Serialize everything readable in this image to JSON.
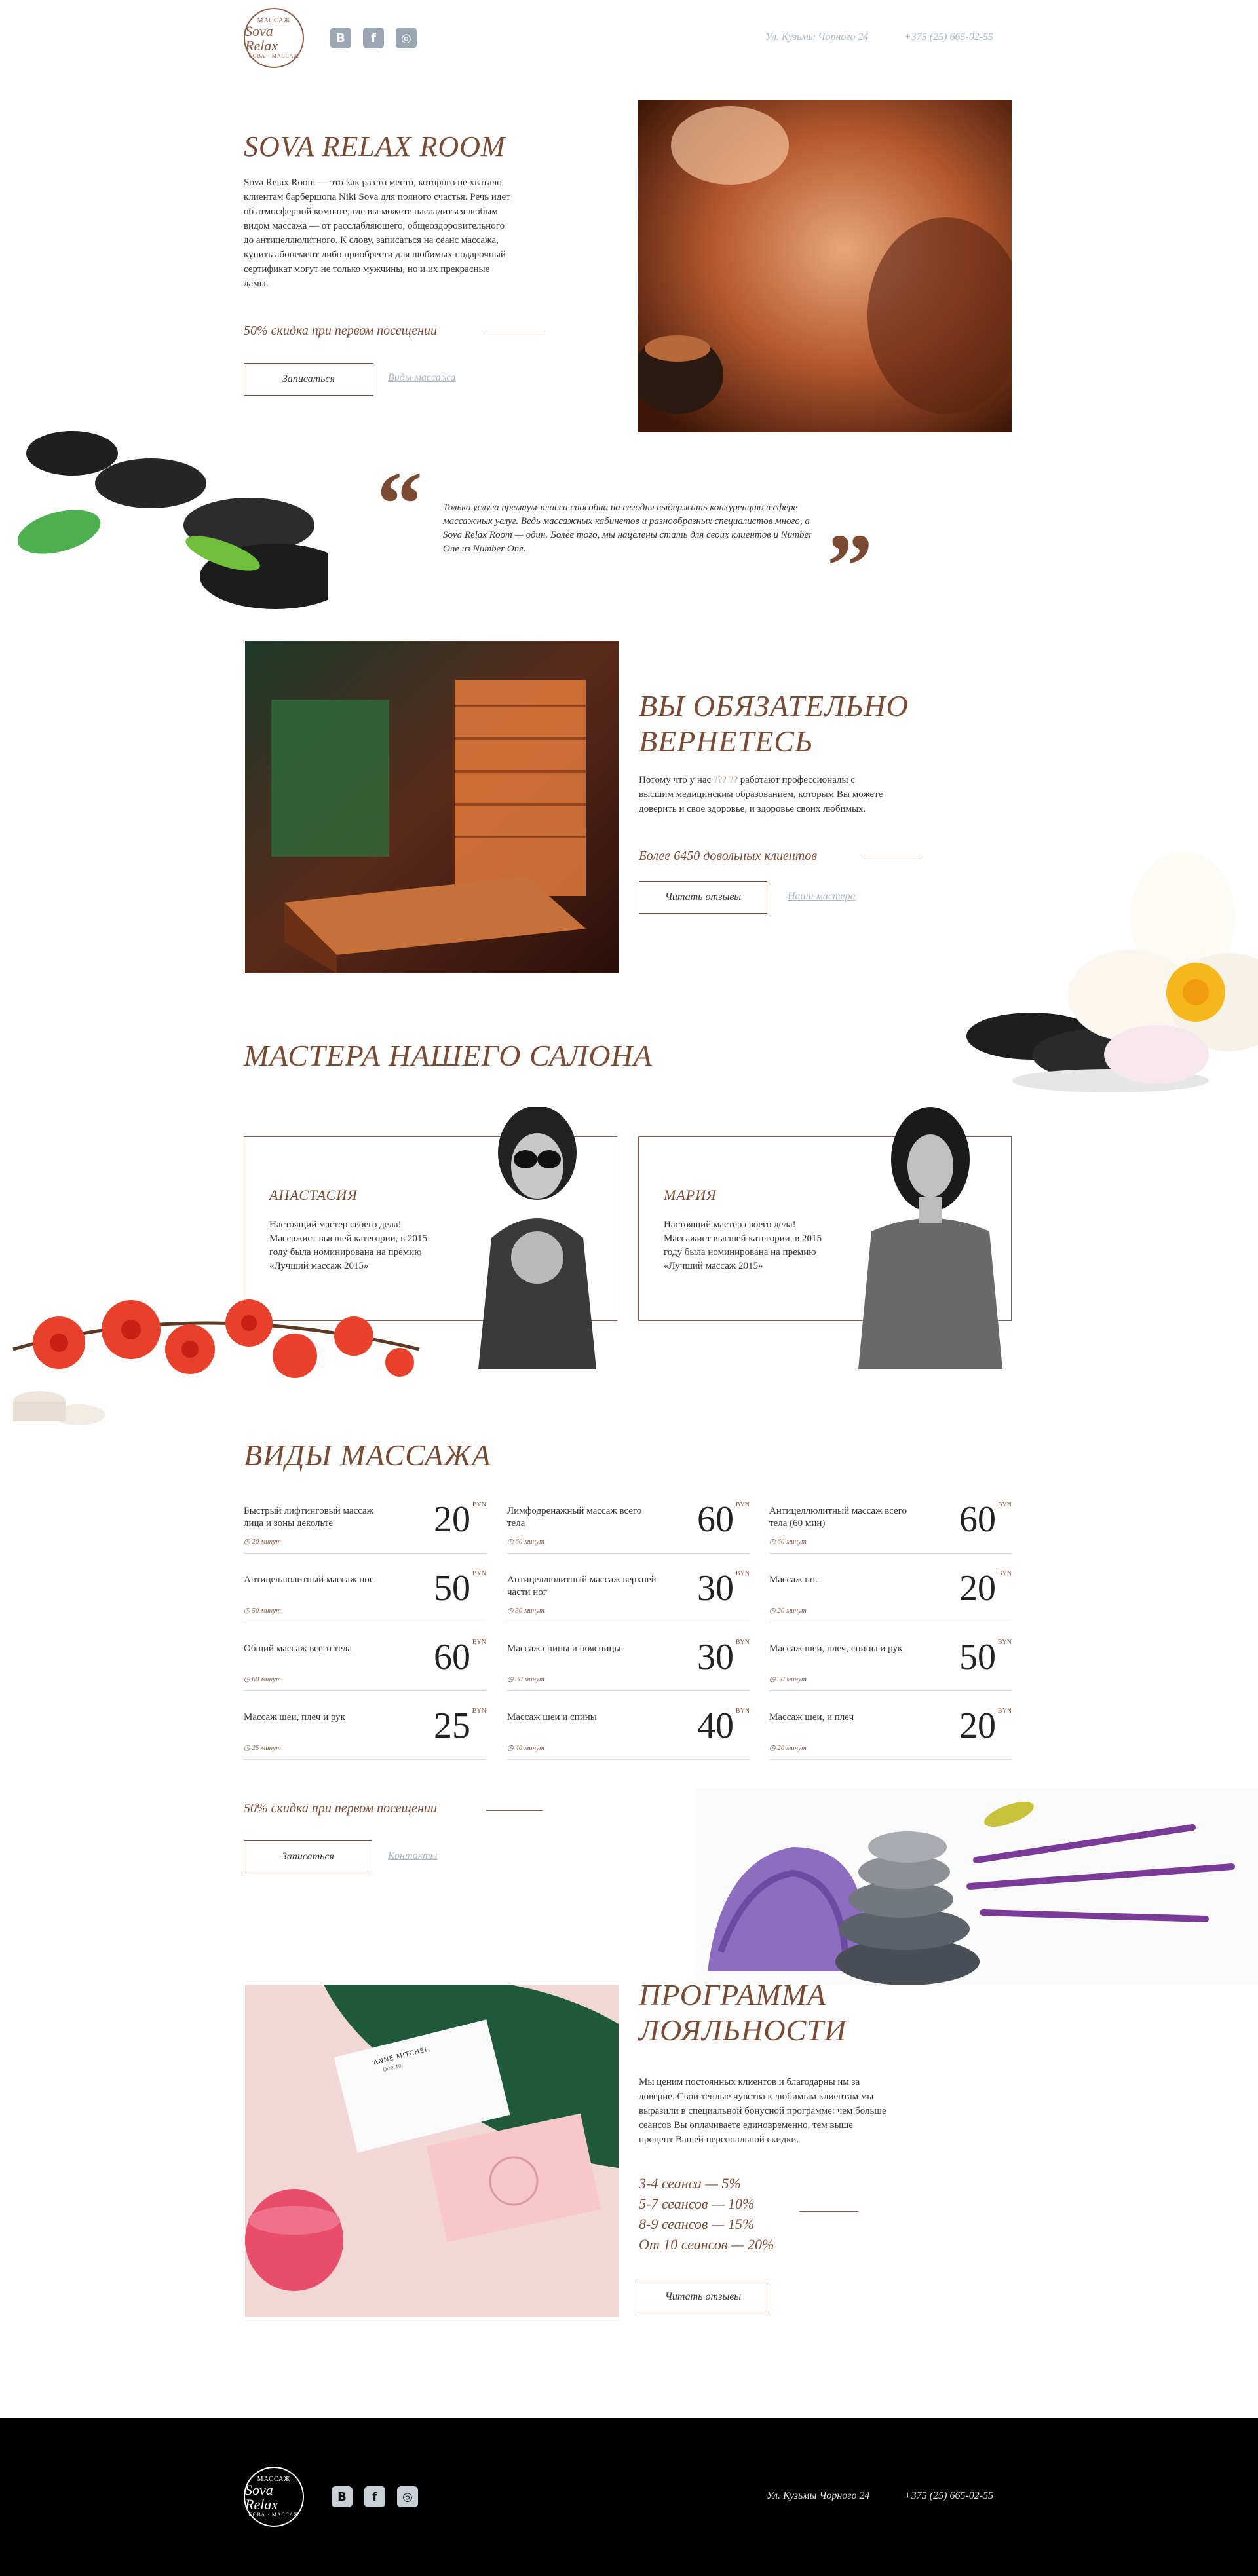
{
  "header": {
    "logo": {
      "top": "МАССАЖ",
      "script": "Sova Relax",
      "bottom": "СОВА · МАССАЖ"
    },
    "social": [
      "B",
      "f",
      "◎"
    ],
    "address": "Ул. Кузьмы Чорного 24",
    "phone": "+375 (25) 665-02-55"
  },
  "hero": {
    "title": "SOVA RELAX ROOM",
    "text": "Sova Relax Room — это как раз то место, которого не хватало клиентам барбершопа Niki Sova для полного счастья. Речь идет об атмосферной комнате, где вы можете насладиться любым видом массажа — от расслабляющего, общеоздоровительного до антицеллюлитного. К слову, записаться на сеанс массажа, купить абонемент либо приобрести для любимых подарочный сертификат могут не только мужчины, но и их прекрасные дамы.",
    "discount": "50% скидка при первом посещении",
    "btn": "Записаться",
    "link": "Виды массажа"
  },
  "quote": {
    "open": "“",
    "close": "”",
    "text": "Только услуга премиум-класса способна на сегодня выдержать конкуренцию в сфере массажных услуг. Ведь массажных кабинетов и разнообразных специалистов много, а Sova Relax Room — один. Более того, мы нацелены стать для своих клиентов и Number One из Number One."
  },
  "return": {
    "title_1": "ВЫ ОБЯЗАТЕЛЬНО",
    "title_2": "ВЕРНЕТЕСЬ",
    "text": "Потому что у нас (!) работают профессионалы с высшим медицинским образованием, которым Вы можете доверить и свое здоровье, и здоровье своих любимых.",
    "text_pre": "Потому что у нас ",
    "text_link": "??? ??",
    "text_post": " работают профессионалы с высшим медицинским образованием, которым Вы можете доверить и свое здоровье, и здоровье своих любимых.",
    "stat": "Более 6450 довольных клиентов",
    "btn": "Читать отзывы",
    "link": "Наши мастера"
  },
  "masters": {
    "title": "МАСТЕРА НАШЕГО САЛОНА",
    "items": [
      {
        "name": "АНАСТАСИЯ",
        "text": "Настоящий мастер своего дела! Массажист высшей категории, в 2015 году была номинирована на премию «Лучший массаж 2015»"
      },
      {
        "name": "МАРИЯ",
        "text": "Настоящий мастер своего дела! Массажист высшей категории, в 2015 году была номинирована на премию «Лучший массаж 2015»"
      }
    ]
  },
  "massage": {
    "title": "ВИДЫ МАССАЖА",
    "currency": "BYN",
    "items": [
      {
        "name": "Быстрый лифтинговый массаж лица и зоны декольте",
        "time": "20 минут",
        "price": "20"
      },
      {
        "name": "Лимфодренажный массаж всего тела",
        "time": "60 минут",
        "price": "60"
      },
      {
        "name": "Антицеллюлитный массаж всего тела (60 мин)",
        "time": "60 минут",
        "price": "60"
      },
      {
        "name": "Антицеллюлитный массаж ног",
        "time": "50 минут",
        "price": "50"
      },
      {
        "name": "Антицеллюлитный массаж верхней части ног",
        "time": "30 минут",
        "price": "30"
      },
      {
        "name": "Массаж ног",
        "time": "20 минут",
        "price": "20"
      },
      {
        "name": "Общий массаж всего тела",
        "time": "60 минут",
        "price": "60"
      },
      {
        "name": "Массаж спины и поясницы",
        "time": "30 минут",
        "price": "30"
      },
      {
        "name": "Массаж шеи, плеч, спины и рук",
        "time": "50 минут",
        "price": "50"
      },
      {
        "name": "Массаж шеи, плеч и рук",
        "time": "25 минут",
        "price": "25"
      },
      {
        "name": "Массаж шеи и спины",
        "time": "40 минут",
        "price": "40"
      },
      {
        "name": "Массаж шеи, и плеч",
        "time": "20 минут",
        "price": "20"
      }
    ],
    "discount": "50% скидка при первом посещении",
    "btn": "Записаться",
    "link": "Контакты"
  },
  "loyalty": {
    "title_1": "ПРОГРАММА",
    "title_2": "ЛОЯЛЬНОСТИ",
    "text": "Мы ценим постоянных клиентов и благодарны им за доверие. Свои теплые чувства к любимым клиентам мы выразили в специальной бонусной программе: чем больше сеансов Вы оплачиваете единовременно, тем выше процент Вашей персональной скидки.",
    "tiers": [
      "3-4 сеанса — 5%",
      "5-7 сеансов — 10%",
      "8-9 сеансов — 15%",
      "От 10 сеансов — 20%"
    ],
    "btn": "Читать отзывы",
    "card": {
      "name": "ANNE MITCHEL",
      "role": "Director"
    }
  },
  "footer": {
    "logo": {
      "top": "МАССАЖ",
      "script": "Sova Relax",
      "bottom": "СОВА · МАССАЖ"
    },
    "social": [
      "B",
      "f",
      "◎"
    ],
    "address": "Ул. Кузьмы Чорного 24",
    "phone": "+375 (25) 665-02-55"
  },
  "colors": {
    "accent": "#7a4a33",
    "muted": "#a9b6c3",
    "footer_bg": "#000000"
  }
}
